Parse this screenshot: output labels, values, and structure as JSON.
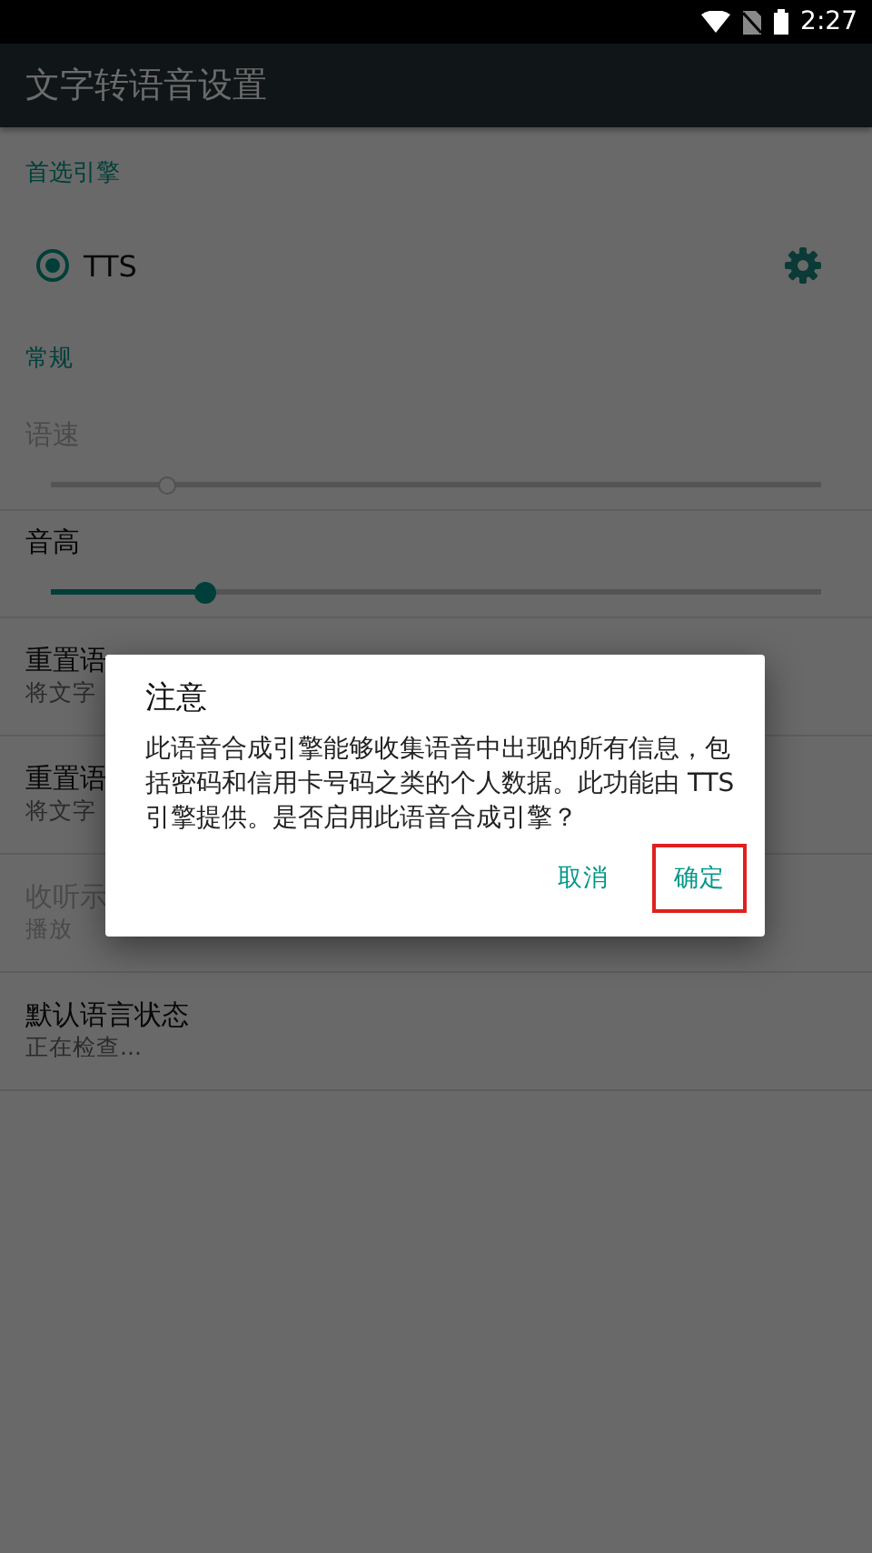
{
  "status_bar": {
    "time": "2:27"
  },
  "app_bar": {
    "title": "文字转语音设置"
  },
  "sections": [
    {
      "header": "首选引擎",
      "items": [
        {
          "kind": "engine",
          "label": "TTS",
          "selected": true
        }
      ]
    },
    {
      "header": "常规",
      "items": [
        {
          "kind": "slider",
          "title": "语速",
          "disabled": true,
          "level": 0.15
        },
        {
          "kind": "slider",
          "title": "音高",
          "disabled": false,
          "level": 0.2
        },
        {
          "kind": "text",
          "title": "重置语",
          "subtitle": "将文字",
          "disabled": false
        },
        {
          "kind": "text",
          "title": "重置语",
          "subtitle": "将文字",
          "disabled": false
        },
        {
          "kind": "text",
          "title": "收听示",
          "subtitle": "播放",
          "disabled": true
        },
        {
          "kind": "text",
          "title": "默认语言状态",
          "subtitle": "正在检查...",
          "disabled": false
        }
      ]
    }
  ],
  "dialog": {
    "title": "注意",
    "message": "此语音合成引擎能够收集语音中出现的所有信息，包括密码和信用卡号码之类的个人数据。此功能由 TTS 引擎提供。是否启用此语音合成引擎？",
    "buttons": [
      {
        "label": "取消",
        "highlighted": false
      },
      {
        "label": "确定",
        "highlighted": true
      }
    ]
  }
}
